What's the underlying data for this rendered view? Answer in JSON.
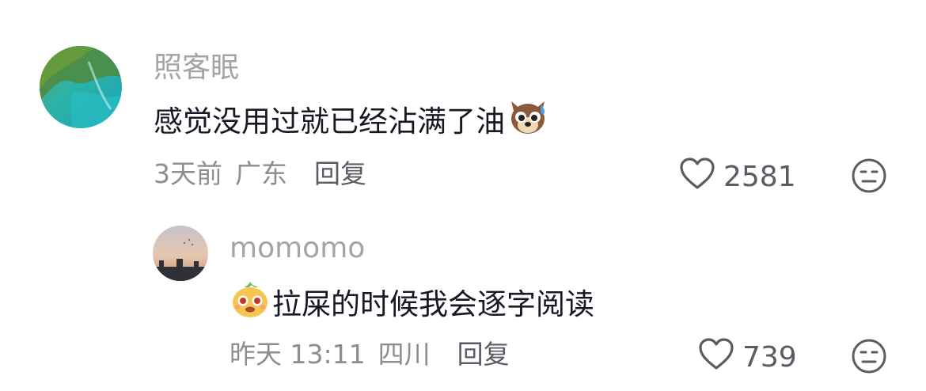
{
  "comments": [
    {
      "username": "照客眠",
      "text": "感觉没用过就已经沾满了油",
      "emoji_after": "dog-sweat-emoji",
      "time": "3天前",
      "location": "广东",
      "reply_label": "回复",
      "likes": "2581"
    },
    {
      "username": "momomo",
      "text": "拉屎的时候我会逐字阅读",
      "emoji_before": "bun-face-emoji",
      "time": "昨天 13:11",
      "location": "四川",
      "reply_label": "回复",
      "likes": "739"
    }
  ],
  "icons": {
    "like": "heart-outline-icon",
    "dislike": "meh-face-icon"
  },
  "colors": {
    "username": "#a4a4a6",
    "text": "#161823",
    "meta": "#8d8d91",
    "action": "#5a5b63"
  }
}
